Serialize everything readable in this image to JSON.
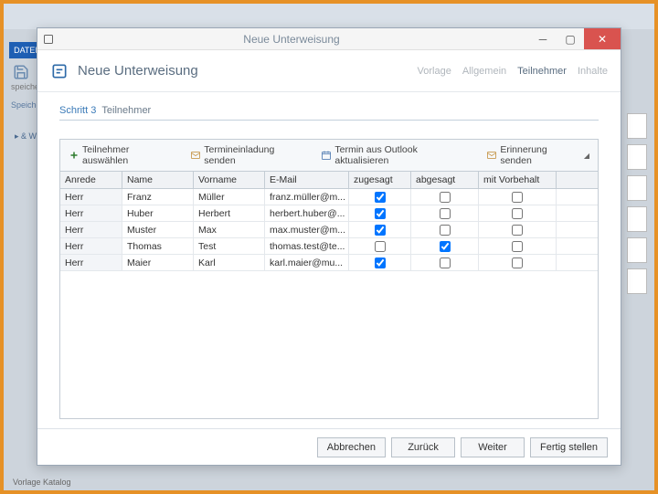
{
  "bg": {
    "file_tab": "DATEI",
    "label1": "speichern",
    "label2": "Speiche",
    "tree_item": "▸ & W",
    "footer": "Vorlage Katalog"
  },
  "titlebar": {
    "title": "Neue Unterweisung"
  },
  "header": {
    "title": "Neue Unterweisung",
    "steps": [
      {
        "label": "Vorlage",
        "active": false
      },
      {
        "label": "Allgemein",
        "active": false
      },
      {
        "label": "Teilnehmer",
        "active": true
      },
      {
        "label": "Inhalte",
        "active": false
      }
    ]
  },
  "step": {
    "prefix": "Schritt 3",
    "name": "Teilnehmer"
  },
  "toolbar": {
    "items": [
      {
        "label": "Teilnehmer auswählen",
        "icon": "plus"
      },
      {
        "label": "Termineinladung senden",
        "icon": "mail"
      },
      {
        "label": "Termin aus Outlook aktualisieren",
        "icon": "calendar"
      },
      {
        "label": "Erinnerung senden",
        "icon": "mail",
        "dropdown": true
      }
    ]
  },
  "grid": {
    "columns": [
      "Anrede",
      "Name",
      "Vorname",
      "E-Mail",
      "zugesagt",
      "abgesagt",
      "mit Vorbehalt"
    ],
    "rows": [
      {
        "anrede": "Herr",
        "name": "Franz",
        "vorname": "Müller",
        "email": "franz.müller@m...",
        "zugesagt": true,
        "abgesagt": false,
        "vorbehalt": false
      },
      {
        "anrede": "Herr",
        "name": "Huber",
        "vorname": "Herbert",
        "email": "herbert.huber@...",
        "zugesagt": true,
        "abgesagt": false,
        "vorbehalt": false
      },
      {
        "anrede": "Herr",
        "name": "Muster",
        "vorname": "Max",
        "email": "max.muster@m...",
        "zugesagt": true,
        "abgesagt": false,
        "vorbehalt": false
      },
      {
        "anrede": "Herr",
        "name": "Thomas",
        "vorname": "Test",
        "email": "thomas.test@te...",
        "zugesagt": false,
        "abgesagt": true,
        "vorbehalt": false
      },
      {
        "anrede": "Herr",
        "name": "Maier",
        "vorname": "Karl",
        "email": "karl.maier@mu...",
        "zugesagt": true,
        "abgesagt": false,
        "vorbehalt": false
      }
    ]
  },
  "footer": {
    "cancel": "Abbrechen",
    "back": "Zurück",
    "next": "Weiter",
    "finish": "Fertig stellen"
  }
}
